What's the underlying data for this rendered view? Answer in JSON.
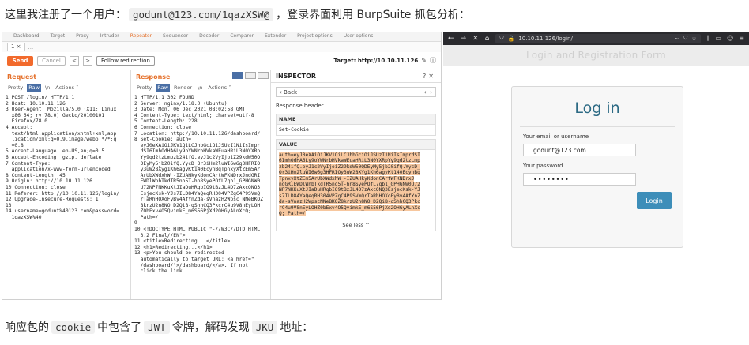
{
  "article": {
    "top_prefix": "这里我注册了一个用户：",
    "top_code": "godunt@123.com/1qazXSW@",
    "top_suffix": "，登录界面利用 BurpSuite 抓包分析：",
    "bottom_text1": "响应包的",
    "bottom_code1": "cookie",
    "bottom_text2": "中包含了",
    "bottom_code2": "JWT",
    "bottom_text3": "令牌，解码发现",
    "bottom_code3": "JKU",
    "bottom_text4": "地址："
  },
  "burp": {
    "top_tabs": [
      "Dashboard",
      "Target",
      "Proxy",
      "Intruder",
      "Repeater",
      "Sequencer",
      "Decoder",
      "Comparer",
      "Extender",
      "Project options",
      "User options"
    ],
    "active_tab_index": 4,
    "subtab_label": "1 ×",
    "subtab_more": "...",
    "send_label": "Send",
    "cancel_label": "Cancel",
    "prev_label": "<",
    "next_label": ">",
    "follow_label": "Follow redirection",
    "target_label": "Target: http://10.10.11.126",
    "request": {
      "title": "Request",
      "tabs": [
        "Pretty",
        "Raw",
        "\\n",
        "Actions ˅"
      ],
      "active_tab": "Raw",
      "lines": [
        "1 POST /login/ HTTP/1.1",
        "2 Host: 10.10.11.126",
        "3 User-Agent: Mozilla/5.0 (X11; Linux",
        "  x86_64; rv:78.0) Gecko/20100101",
        "  Firefox/78.0",
        "4 Accept:",
        "  text/html,application/xhtml+xml,app",
        "  lication/xml;q=0.9,image/webp,*/*;q",
        "  =0.8",
        "5 Accept-Language: en-US,en;q=0.5",
        "6 Accept-Encoding: gzip, deflate",
        "7 Content-Type:",
        "  application/x-www-form-urlencoded",
        "8 Content-Length: 45",
        "9 Origin: http://10.10.11.126",
        "10 Connection: close",
        "11 Referer: http://10.10.11.126/login/",
        "12 Upgrade-Insecure-Requests: 1",
        "13",
        "14 username=godunt%40123.com&password=",
        "  1qazXSW%40"
      ]
    },
    "response": {
      "title": "Response",
      "tabs": [
        "Pretty",
        "Raw",
        "Render",
        "\\n",
        "Actions ˅"
      ],
      "active_tab": "Raw",
      "lines": [
        "1 HTTP/1.1 302 FOUND",
        "2 Server: nginx/1.18.0 (Ubuntu)",
        "3 Date: Mon, 06 Dec 2021 08:02:58 GMT",
        "4 Content-Type: text/html; charset=utf-8",
        "5 Content-Length: 228",
        "6 Connection: close",
        "7 Location: http://10.10.11.126/dashboard/",
        "8 Set-Cookie: auth=",
        "  eyJ0eXAiOiJKV1QiLCJhbGciOiJSUzI1NiIsImpr",
        "  dSI6ImhOdHA6Ly9oYWNrbHVkaWEuaHRiL3N0YXRp",
        "  Yy9qd2tzLmpzb24ifQ.eyJ1c2VyIjoiZ29kdW50Q",
        "  DEyMy5jb20ifQ.YycD_Or3iHm2luWI6w6g3HFRIO",
        "  y3uW28Xyg1Kh6agyKt140EcynBqTpnxyXtZEm5Ar",
        "  ArUbXWdxhW_-IZUAHkyKdonCArtWFKNDrxJndGRI",
        "  EWDlWnbTkdTR5no5T-hn8SyePOfL7qb1_GPHGNW0",
        "  U72NP7NKKuXtJIaDuHRqbIO9tBzJL4D7zAxcQNQ3",
        "  EsjecKsk-YJs7ILD84YaQeqRH304VPZgC4P9SVmQ",
        "  rTaRhHOXoFyBv4AfYnZda-sVnazH2Wpsc NNeBKQZ",
        "  8krzU2n8NO_D2QiB-qShhCQ3PkcrC4u9V8nEyLOH",
        "  Z0bExv4O5QvimkE_m6S56PjXd2OHGyALnXcQ;",
        "  Path=/",
        "9",
        "10 <!DOCTYPE HTML PUBLIC \"-//W3C//DTD HTML",
        "  3.2 Final//EN\">",
        "11 <title>Redirecting...</title>",
        "12 <h1>Redirecting...</h1>",
        "13 <p>You should be redirected",
        "  automatically to target URL: <a href=\"",
        "  /dashboard/\">/dashboard/</a>. If not",
        "  click the link."
      ]
    },
    "inspector": {
      "title": "INSPECTOR",
      "back_label": "Back",
      "section_label": "Response header",
      "name_header": "NAME",
      "name_value": "Set-Cookie",
      "value_header": "VALUE",
      "value_lines": [
        "auth=eyJ0eXAiOiJKV1QiLCJhbGciOiJSUzI1NiIsImprdSI",
        "6ImhOdHA6Ly9oYWNrbHVkaWEuaHRiL3N0YXRpYy9qd2tzLmp",
        "zb24ifQ.eyJ1c2VyIjoiZ29kdW50QDEyMy5jb20ifQ.YycD_",
        "Or3iHm2luWI6w6g3HFRIOy3uW28XYg1Kh6agyKt140EcynBq",
        "TpnxyXtZEm5ArUbXWdxhW_-IZUAHkyKdonCArtWFKNDrxJ",
        "ndGRIEWDlWnbTkdTR5no5T-hn8SyePOfL7qb1_GPHGNW0U72",
        "NP7NKKuXtJIaDuHRqbIO9tBzJL4D7zAxcQNQ3EsjecKsk-YJ",
        "s7ILD84YaQeqRH304VPZgC4P9SVmQrTaRhHOXoFyBv4AfYnZ",
        "da-sVnazH2WpscNNeBKQZ8krzU2n8NO_D2QiB-qShhCQ3Pkc",
        "rC4u9V8nEyLOHZ0bExv4O5QvimkE_m6S56PjXd2OHGyALnXc",
        "Q; Path=/"
      ],
      "see_less_label": "See less ^"
    }
  },
  "firefox": {
    "url": "10.10.11.126/login/",
    "page_banner": "Login and Registration Form",
    "login_title": "Log in",
    "email_label": "Your email or username",
    "email_value": "godunt@123.com",
    "password_label": "Your password",
    "password_value": "••••••••",
    "login_button": "Login"
  }
}
